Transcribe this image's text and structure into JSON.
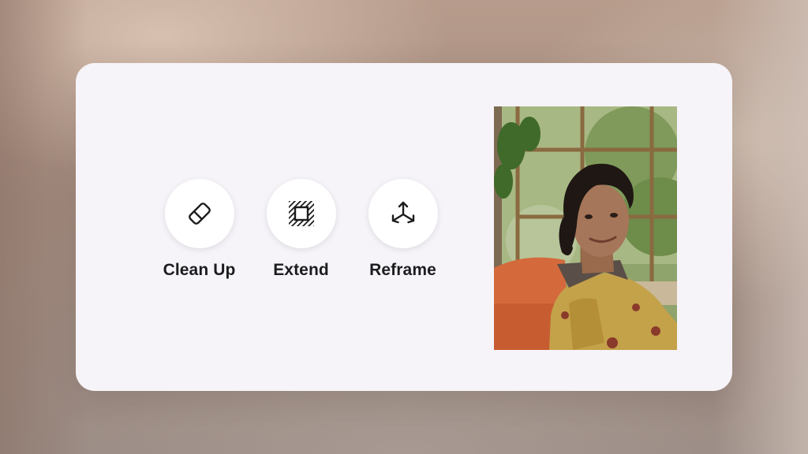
{
  "tools": [
    {
      "label": "Clean Up",
      "icon": "eraser-icon"
    },
    {
      "label": "Extend",
      "icon": "extend-frame-icon"
    },
    {
      "label": "Reframe",
      "icon": "reframe-axes-icon"
    }
  ],
  "photo": {
    "subject": "portrait-photo"
  },
  "colors": {
    "card": "#f6f4f9",
    "label": "#1c1c1e",
    "button": "#ffffff"
  }
}
